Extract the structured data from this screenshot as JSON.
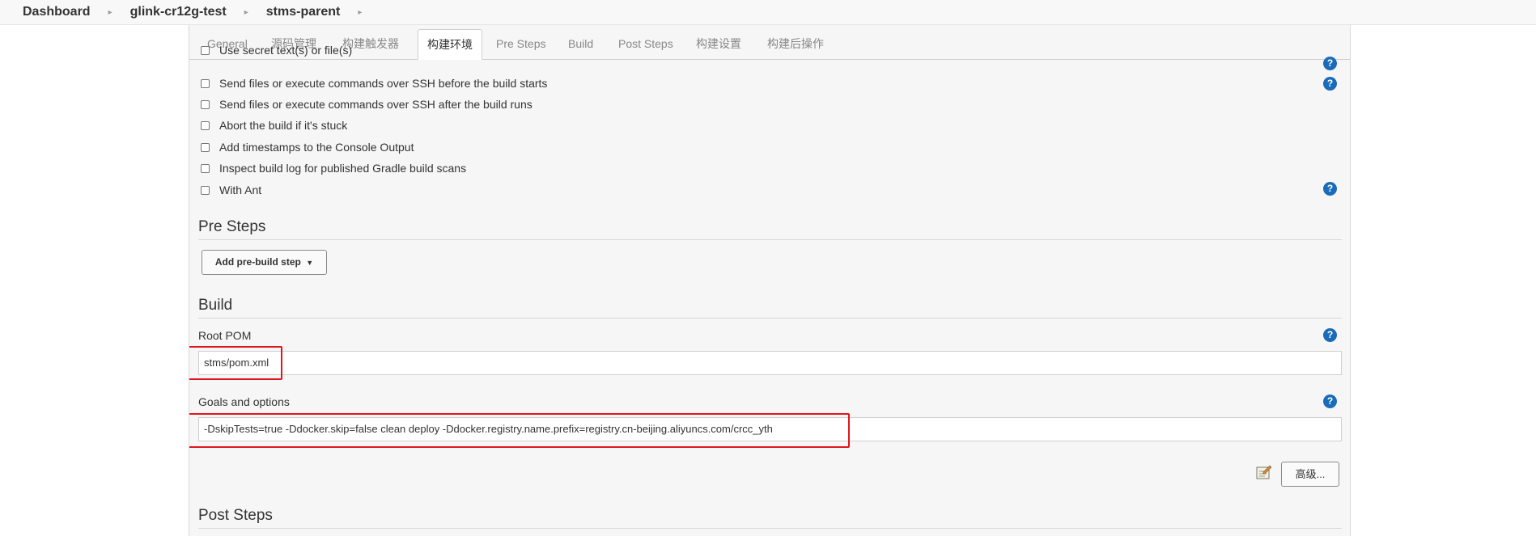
{
  "breadcrumb": {
    "items": [
      "Dashboard",
      "glink-cr12g-test",
      "stms-parent"
    ]
  },
  "tabs": [
    "General",
    "源码管理",
    "构建触发器",
    "构建环境",
    "Pre Steps",
    "Build",
    "Post Steps",
    "构建设置",
    "构建后操作"
  ],
  "active_tab": "构建环境",
  "build_env": {
    "options": [
      "Use secret text(s) or file(s)",
      "Send files or execute commands over SSH before the build starts",
      "Send files or execute commands over SSH after the build runs",
      "Abort the build if it's stuck",
      "Add timestamps to the Console Output",
      "Inspect build log for published Gradle build scans",
      "With Ant"
    ],
    "help_glyph": "?"
  },
  "pre_steps": {
    "title": "Pre Steps",
    "add_button": "Add pre-build step"
  },
  "build": {
    "title": "Build",
    "root_pom_label": "Root POM",
    "root_pom_value": "stms/pom.xml",
    "goals_label": "Goals and options",
    "goals_value": "-DskipTests=true -Ddocker.skip=false clean deploy -Ddocker.registry.name.prefix=registry.cn-beijing.aliyuncs.com/crcc_yth",
    "advanced_button": "高级..."
  },
  "post_steps": {
    "title": "Post Steps"
  },
  "colors": {
    "highlight": "#e0161d",
    "help_icon": "#1a6cb8"
  },
  "icons": [
    "chevron-right-icon",
    "help-icon",
    "dropdown-caret-icon",
    "notepad-edit-icon"
  ]
}
